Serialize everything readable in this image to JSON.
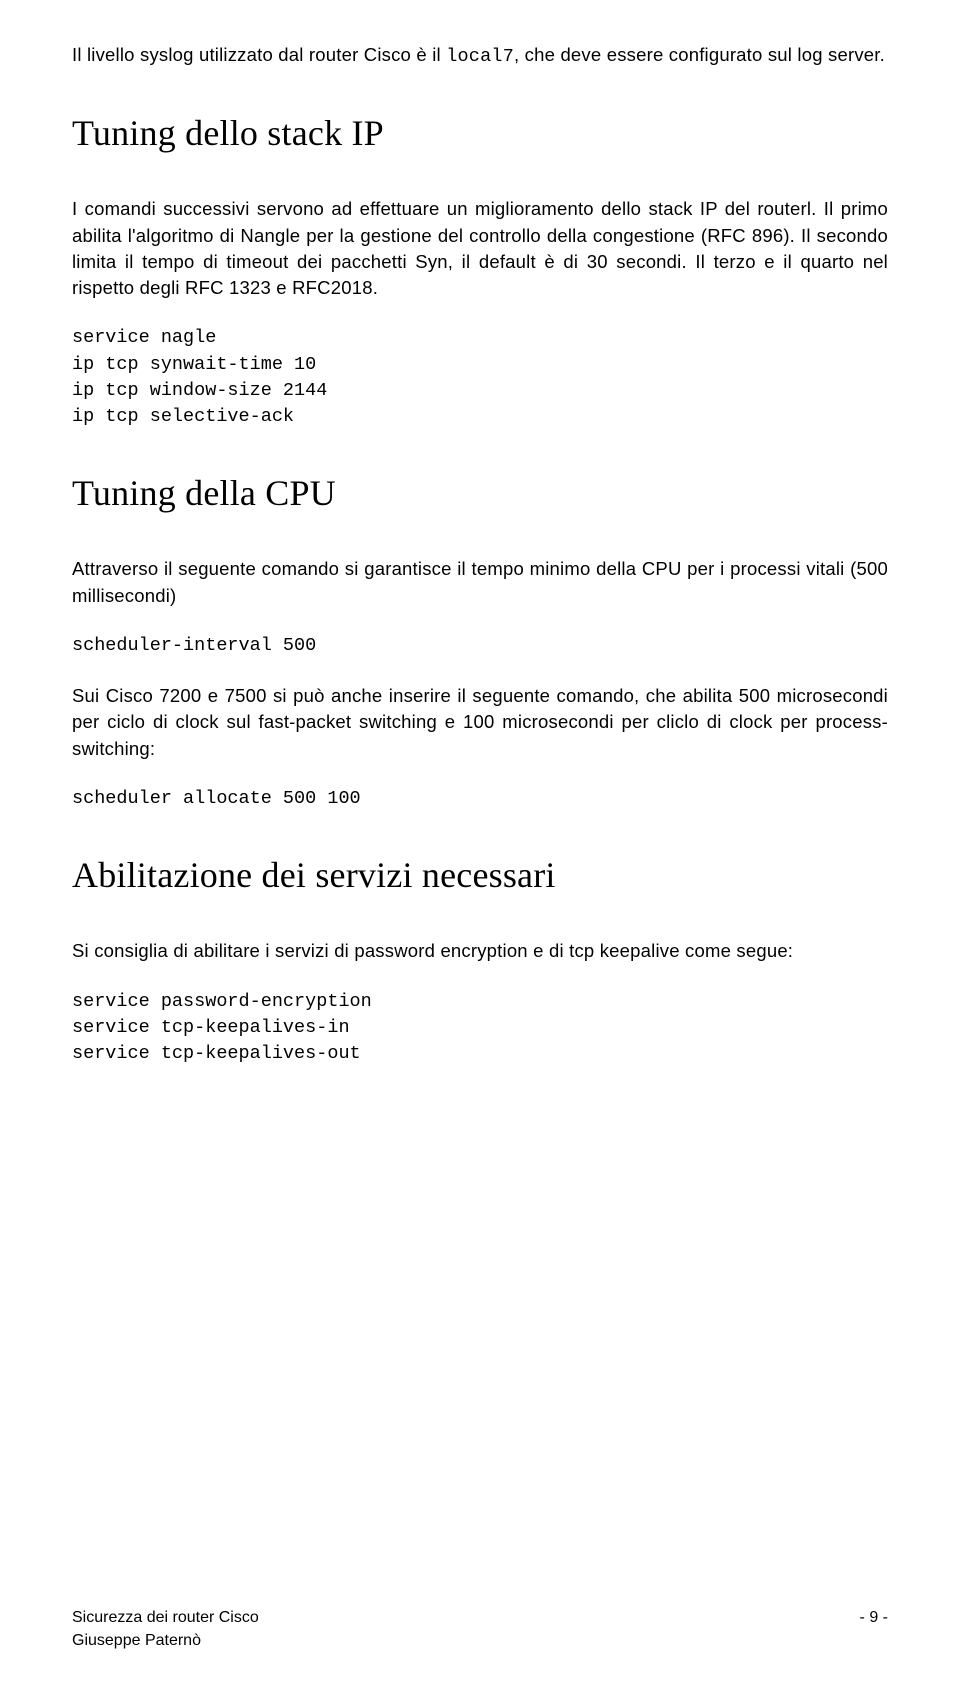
{
  "intro_para_pre": "Il livello syslog utilizzato dal router Cisco è il ",
  "intro_para_code": "local7",
  "intro_para_post": ", che deve essere configurato sul log server.",
  "h_tuning_ip": "Tuning dello stack IP",
  "tuning_ip_para": "I comandi successivi servono ad effettuare un miglioramento dello stack IP del routerl. Il primo abilita l'algoritmo di Nangle per la gestione del controllo della congestione (RFC 896). Il secondo limita il tempo di timeout dei pacchetti Syn, il default è di 30 secondi. Il terzo e il quarto nel rispetto degli RFC 1323 e RFC2018.",
  "tuning_ip_code": "service nagle\nip tcp synwait-time 10\nip tcp window-size 2144\nip tcp selective-ack",
  "h_tuning_cpu": "Tuning della CPU",
  "tuning_cpu_para1": "Attraverso il seguente comando si garantisce il tempo minimo della CPU per i processi vitali (500 millisecondi)",
  "tuning_cpu_code1": "scheduler-interval 500",
  "tuning_cpu_para2": "Sui Cisco 7200 e 7500 si può anche inserire il seguente comando, che abilita 500 microsecondi per ciclo di clock sul fast-packet switching e 100 microsecondi per cliclo di clock per process-switching:",
  "tuning_cpu_code2": "scheduler allocate 500 100",
  "h_servizi": "Abilitazione dei servizi necessari",
  "servizi_para": "Si consiglia di abilitare i servizi di password encryption e di tcp keepalive come segue:",
  "servizi_code": "service password-encryption\nservice tcp-keepalives-in\nservice tcp-keepalives-out",
  "footer_title": "Sicurezza dei router Cisco",
  "footer_author": "Giuseppe Paternò",
  "footer_page": "- 9 -"
}
